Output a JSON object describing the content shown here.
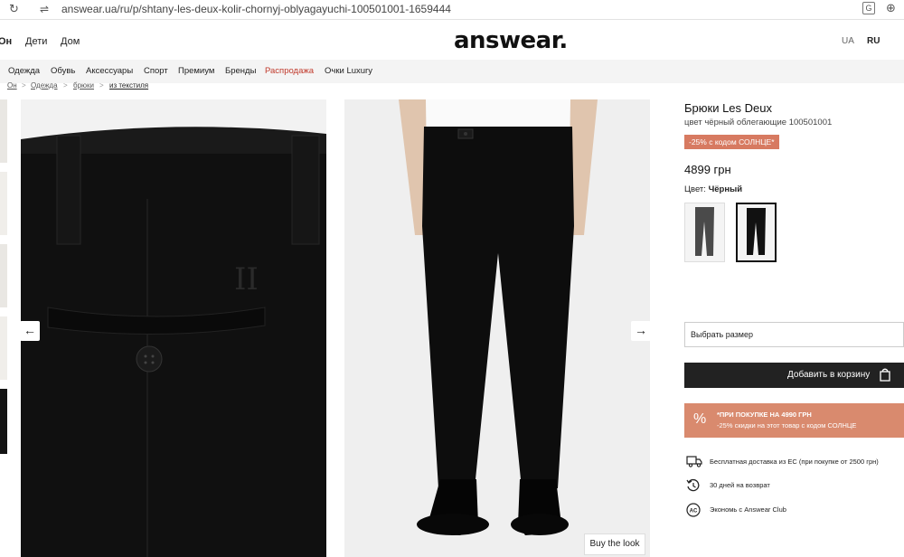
{
  "browser": {
    "url": "answear.ua/ru/p/shtany-les-deux-kolir-chornyj-oblyagayuchi-100501001-1659444",
    "reload_icon": "↻",
    "tune_icon": "⇌",
    "translate_icon": "G",
    "zoom_icon": "⊕"
  },
  "header": {
    "gender_tabs": [
      "Он",
      "Дети",
      "Дом"
    ],
    "logo": "answear.",
    "languages": [
      "UA",
      "RU"
    ]
  },
  "nav": {
    "items": [
      "Одежда",
      "Обувь",
      "Аксессуары",
      "Спорт",
      "Премиум",
      "Бренды",
      "Распродажа",
      "Очки Luxury"
    ]
  },
  "breadcrumb": {
    "items": [
      "Он",
      "Одежда",
      "брюки",
      "из текстиля"
    ],
    "separator": ">"
  },
  "gallery": {
    "prev_icon": "←",
    "next_icon": "→",
    "buy_the_look": "Buy the look"
  },
  "product": {
    "title": "Брюки Les Deux",
    "subtitle": "цвет чёрный облегающие 100501001",
    "promo_badge": "-25% с кодом СОЛНЦЕ*",
    "price": "4899 грн",
    "color_label": "Цвет:",
    "color_value": "Чёрный",
    "size_placeholder": "Выбрать размер",
    "add_to_cart": "Добавить в корзину",
    "promo_box": {
      "line1": "*ПРИ ПОКУПКЕ НА 4990 ГРН",
      "line2": "-25% скидки на этот товар с кодом СОЛНЦЕ",
      "icon": "%"
    },
    "perks": [
      {
        "icon": "truck-icon",
        "text": "Бесплатная доставка из ЕС (при покупке от 2500 грн)"
      },
      {
        "icon": "return-icon",
        "text": "30 дней на возврат"
      },
      {
        "icon": "club-icon",
        "text": "Экономь с Answear Club",
        "badge": "AC"
      }
    ]
  },
  "colors": {
    "promo": "#d77a61",
    "promo_box": "#d98a6e",
    "cart_button": "#222222",
    "sale_nav": "#c0392b"
  }
}
